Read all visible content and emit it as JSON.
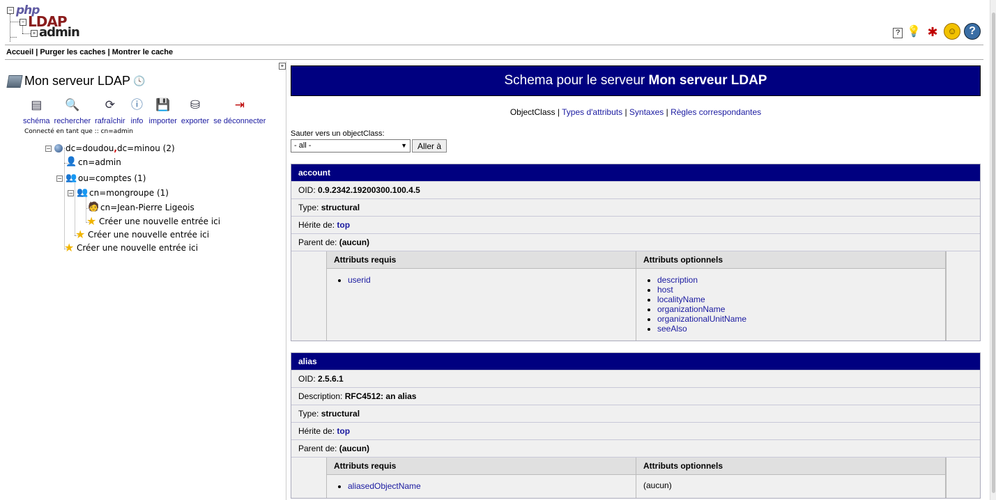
{
  "header": {
    "logo": {
      "php": "php",
      "ldap": "LDAP",
      "admin": "admin"
    },
    "nav": [
      "Accueil",
      "Purger les caches",
      "Montrer le cache"
    ],
    "icons": [
      "help-icon",
      "bulb-icon",
      "bug-icon",
      "smile-icon",
      "question-icon"
    ]
  },
  "left": {
    "server_title": "Mon serveur LDAP",
    "toolbar": [
      {
        "label": "schéma",
        "icon": "schema-icon"
      },
      {
        "label": "rechercher",
        "icon": "search-icon"
      },
      {
        "label": "rafraîchir",
        "icon": "refresh-icon"
      },
      {
        "label": "info",
        "icon": "info-icon"
      },
      {
        "label": "importer",
        "icon": "import-icon"
      },
      {
        "label": "exporter",
        "icon": "export-icon"
      },
      {
        "label": "se déconnecter",
        "icon": "logout-icon"
      }
    ],
    "logged_in_label": "Connecté en tant que ::",
    "logged_in_user": "cn=admin",
    "tree": {
      "root_a": "dc=doudou",
      "root_sep": ",",
      "root_b": "dc=minou",
      "root_count": "(2)",
      "admin": "cn=admin",
      "comptes": "ou=comptes (1)",
      "mongroupe": "cn=mongroupe (1)",
      "person": "cn=Jean-Pierre Ligeois",
      "create": "Créer une nouvelle entrée ici"
    }
  },
  "right": {
    "title_prefix": "Schema pour le serveur",
    "title_server": "Mon serveur LDAP",
    "tabs": {
      "current": "ObjectClass",
      "t1": "Types d'attributs",
      "t2": "Syntaxes",
      "t3": "Règles correspondantes",
      "sep": "|"
    },
    "jump_label": "Sauter vers un objectClass:",
    "jump_value": "- all -",
    "jump_button": "Aller à",
    "labels": {
      "oid": "OID:",
      "type": "Type:",
      "inherits": "Hérite de:",
      "parent": "Parent de:",
      "description": "Description:",
      "required": "Attributs requis",
      "optional": "Attributs optionnels"
    },
    "classes": [
      {
        "name": "account",
        "oid": "0.9.2342.19200300.100.4.5",
        "type": "structural",
        "inherits": "top",
        "parent": "(aucun)",
        "required": [
          "userid"
        ],
        "optional": [
          "description",
          "host",
          "localityName",
          "organizationName",
          "organizationalUnitName",
          "seeAlso"
        ]
      },
      {
        "name": "alias",
        "oid": "2.5.6.1",
        "description": "RFC4512: an alias",
        "type": "structural",
        "inherits": "top",
        "parent": "(aucun)",
        "required": [
          "aliasedObjectName"
        ],
        "optional_none": "(aucun)"
      }
    ]
  }
}
